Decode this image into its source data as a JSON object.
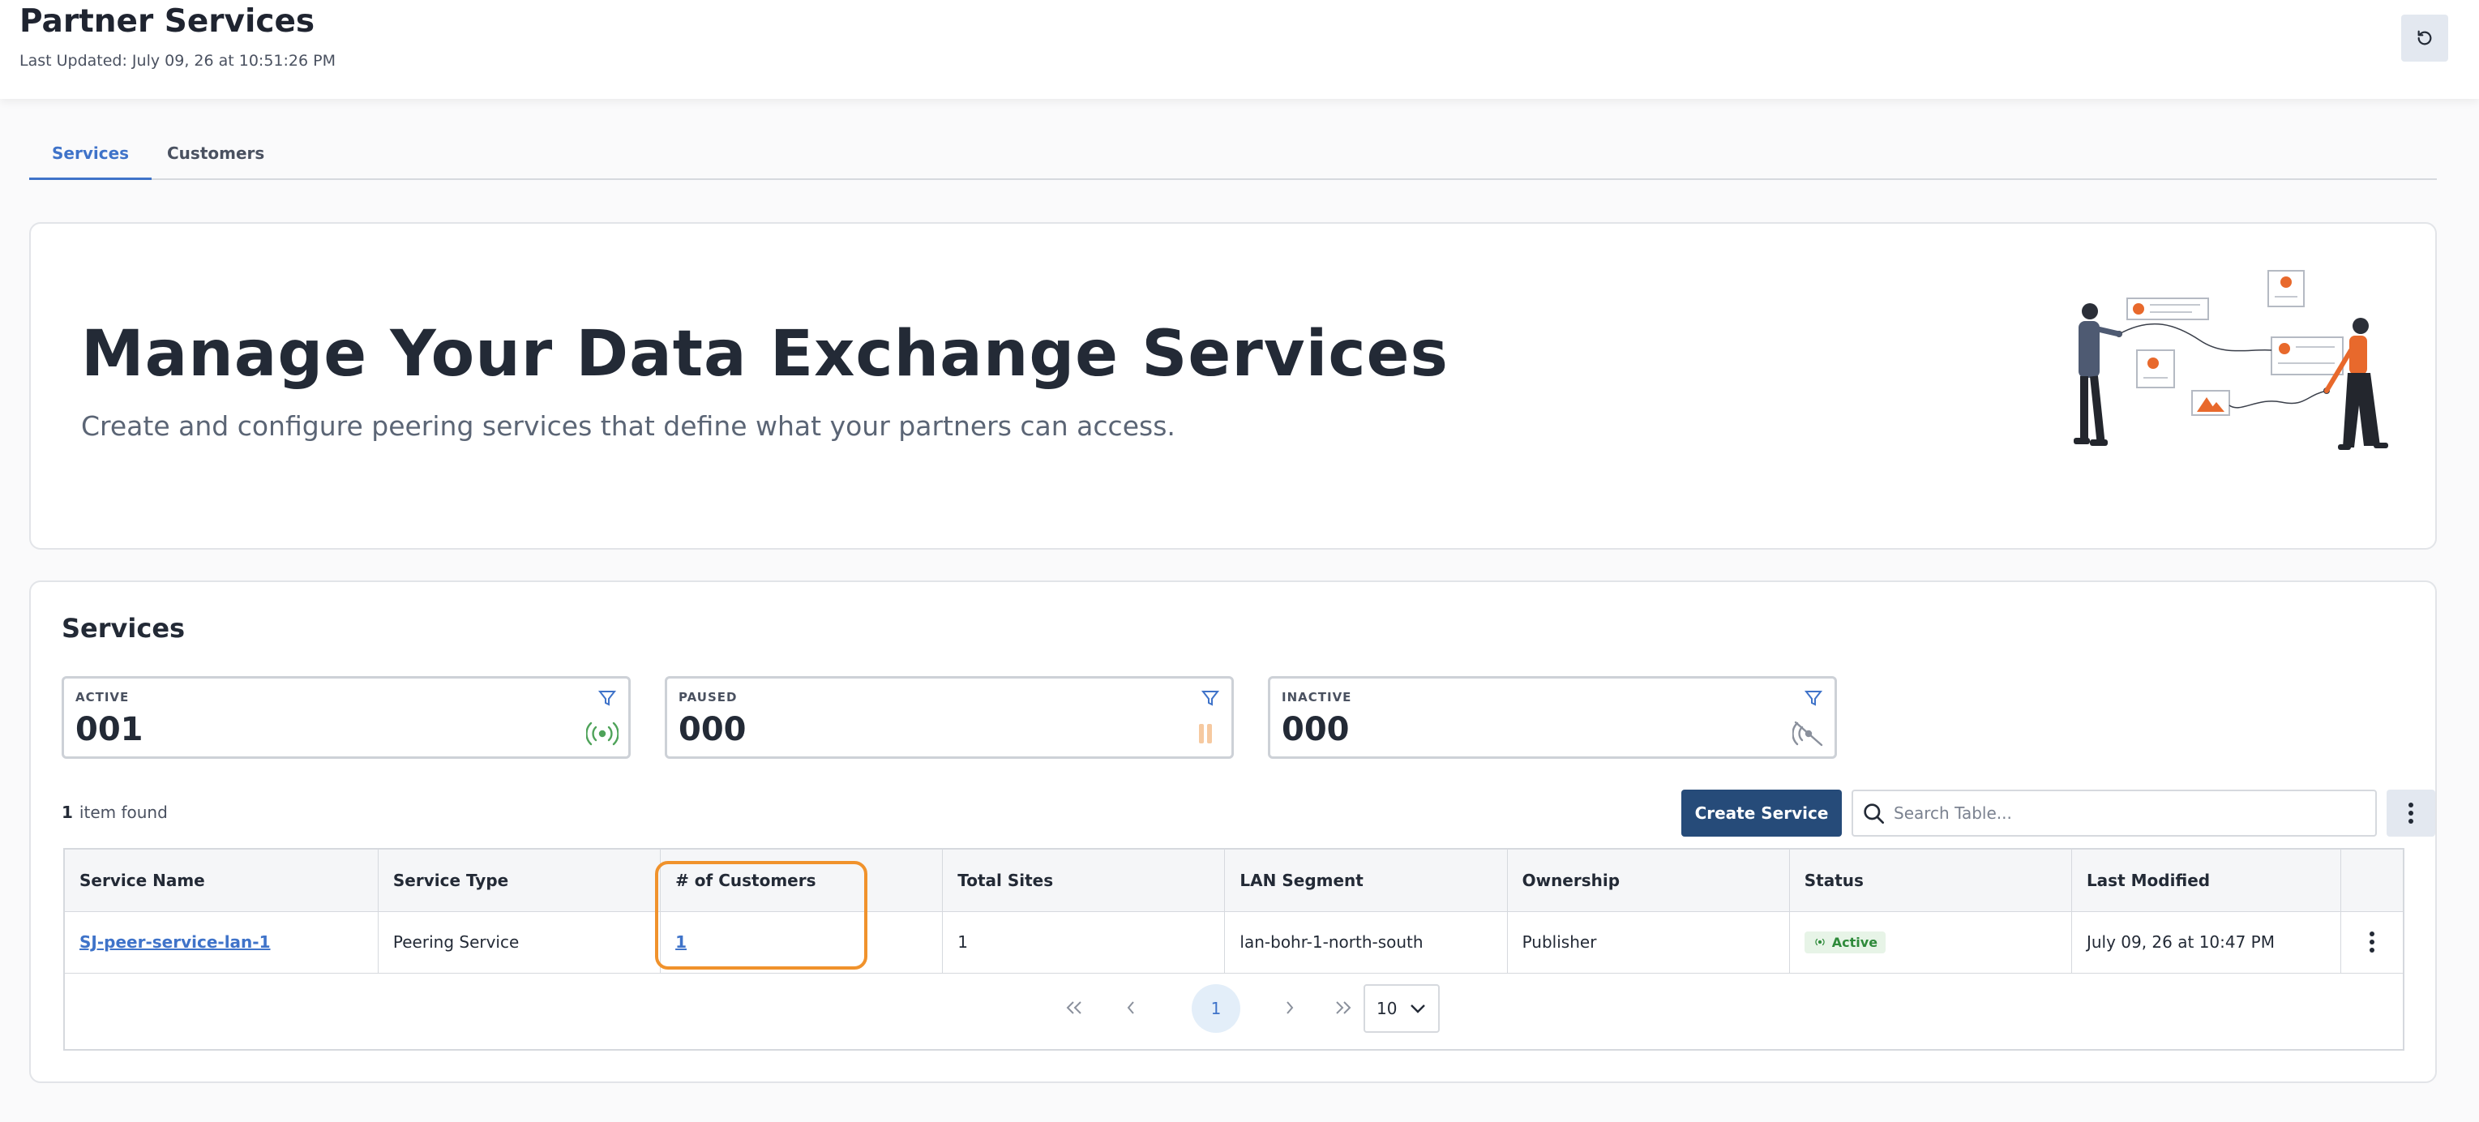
{
  "header": {
    "title": "Partner Services",
    "last_updated": "Last Updated: July 09, 26 at 10:51:26 PM"
  },
  "tabs": [
    {
      "label": "Services",
      "active": true
    },
    {
      "label": "Customers",
      "active": false
    }
  ],
  "hero": {
    "title": "Manage Your Data Exchange Services",
    "subtitle": "Create and configure peering services that define what your partners can access."
  },
  "services": {
    "title": "Services",
    "stats": [
      {
        "label": "ACTIVE",
        "value": "001",
        "icon": "active-signal-icon"
      },
      {
        "label": "PAUSED",
        "value": "000",
        "icon": "pause-icon"
      },
      {
        "label": "INACTIVE",
        "value": "000",
        "icon": "signal-off-icon"
      }
    ],
    "items_found_count": "1",
    "items_found_text": "item found",
    "create_button": "Create Service",
    "search_placeholder": "Search Table...",
    "table": {
      "columns": [
        "Service Name",
        "Service Type",
        "# of Customers",
        "Total Sites",
        "LAN Segment",
        "Ownership",
        "Status",
        "Last Modified"
      ],
      "rows": [
        {
          "service_name": "SJ-peer-service-lan-1",
          "service_type": "Peering Service",
          "customers": "1",
          "total_sites": "1",
          "lan_segment": "lan-bohr-1-north-south",
          "ownership": "Publisher",
          "status": "Active",
          "last_modified": "July 09, 26 at 10:47 PM"
        }
      ]
    },
    "pagination": {
      "current_page": "1",
      "page_size": "10"
    }
  },
  "colors": {
    "accent": "#3f73c9",
    "primary_button": "#264b79",
    "highlight": "#f0922c",
    "active_status": "#2e8a3a"
  }
}
